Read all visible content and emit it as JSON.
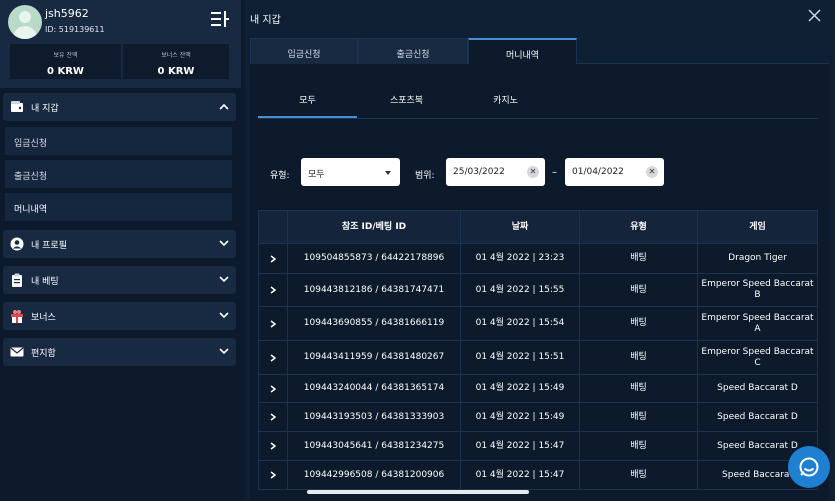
{
  "user": {
    "username": "jsh5962",
    "id_text": "ID: 519139611"
  },
  "balances": [
    {
      "label": "보유 잔액",
      "value": "0 KRW"
    },
    {
      "label": "보너스 잔액",
      "value": "0 KRW"
    }
  ],
  "nav": {
    "wallet": {
      "label": "내 지갑",
      "items": [
        "입금신청",
        "출금신청",
        "머니내역"
      ]
    },
    "profile": "내 프로필",
    "betting": "내 베팅",
    "bonus": "보너스",
    "inbox": "편지함"
  },
  "main": {
    "title": "내 지갑",
    "tabs": [
      "입금신청",
      "출금신청",
      "머니내역"
    ],
    "active_tab": "머니내역",
    "subtabs": [
      "모두",
      "스포츠북",
      "카지노"
    ],
    "filters": {
      "type_label": "유형:",
      "type_value": "모두",
      "range_label": "범위:",
      "date_from": "25/03/2022",
      "date_to": "01/04/2022",
      "range_separator": "–"
    },
    "table": {
      "headers": [
        "참조 ID/베팅 ID",
        "날짜",
        "유형",
        "게임"
      ],
      "rows": [
        {
          "ref": "109504855873 / 64422178896",
          "date": "01 4월 2022 | 23:23",
          "type": "배팅",
          "game": "Dragon Tiger"
        },
        {
          "ref": "109443812186 / 64381747471",
          "date": "01 4월 2022 | 15:55",
          "type": "배팅",
          "game": "Emperor Speed Baccarat B"
        },
        {
          "ref": "109443690855 / 64381666119",
          "date": "01 4월 2022 | 15:54",
          "type": "배팅",
          "game": "Emperor Speed Baccarat A"
        },
        {
          "ref": "109443411959 / 64381480267",
          "date": "01 4월 2022 | 15:51",
          "type": "배팅",
          "game": "Emperor Speed Baccarat C"
        },
        {
          "ref": "109443240044 / 64381365174",
          "date": "01 4월 2022 | 15:49",
          "type": "배팅",
          "game": "Speed Baccarat D"
        },
        {
          "ref": "109443193503 / 64381333903",
          "date": "01 4월 2022 | 15:49",
          "type": "배팅",
          "game": "Speed Baccarat D"
        },
        {
          "ref": "109443045641 / 64381234275",
          "date": "01 4월 2022 | 15:47",
          "type": "배팅",
          "game": "Speed Baccarat D"
        },
        {
          "ref": "109442996508 / 64381200906",
          "date": "01 4월 2022 | 15:47",
          "type": "배팅",
          "game": "Speed Baccarat"
        }
      ]
    }
  },
  "colors": {
    "accent": "#4a8fd2",
    "chat_button": "#1f7fd1",
    "panel": "#0c1a2c"
  },
  "icons": {
    "menu": "menu-icon",
    "close": "close-icon",
    "chat": "chat-icon"
  }
}
